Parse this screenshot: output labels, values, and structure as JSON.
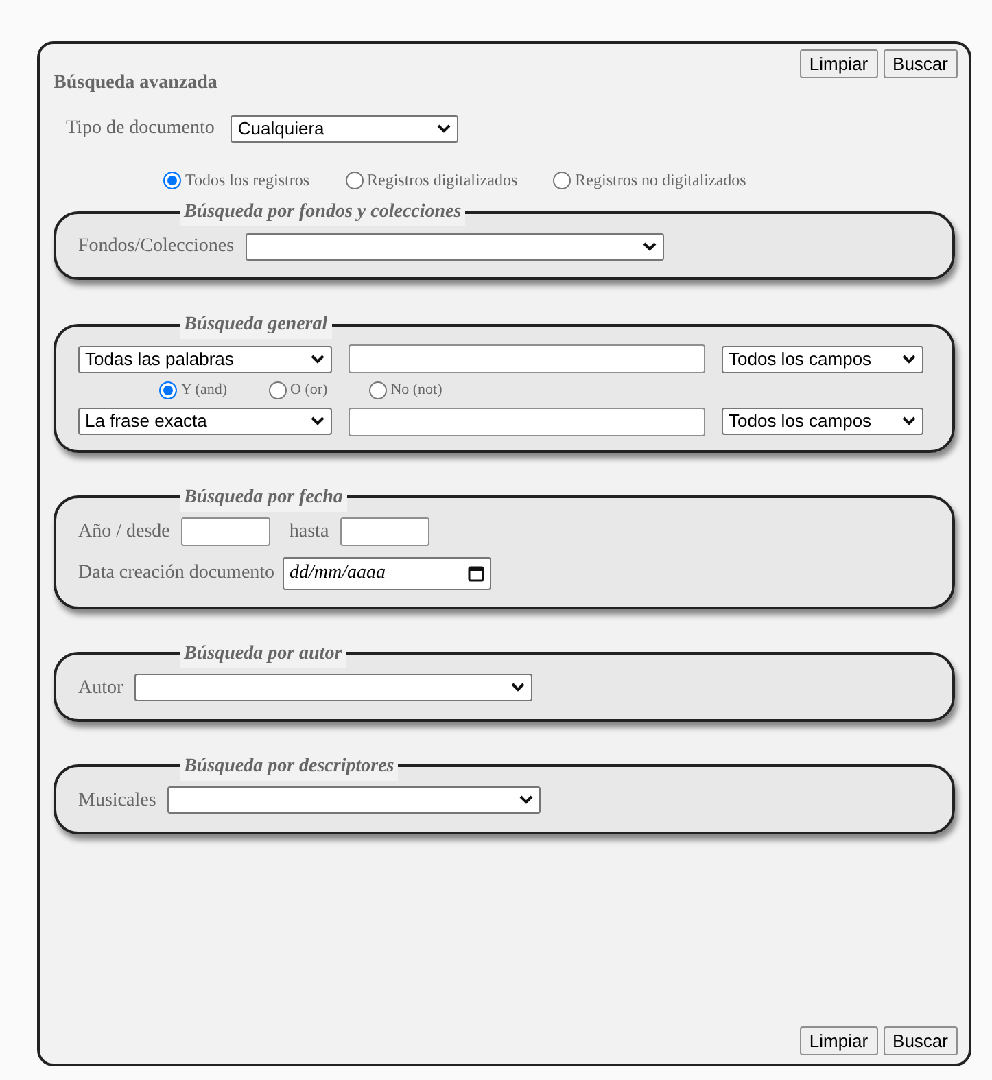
{
  "header": {
    "title": "Búsqueda avanzada",
    "buttons": [
      "Limpiar",
      "Buscar"
    ]
  },
  "document_type": {
    "label": "Tipo de documento",
    "value": "Cualquiera"
  },
  "record_filter": [
    {
      "label": "Todos los registros",
      "selected": true
    },
    {
      "label": "Registros digitalizados",
      "selected": false
    },
    {
      "label": "Registros no digitalizados",
      "selected": false
    }
  ],
  "sections": [
    {
      "kind": "select",
      "legend": "Búsqueda por fondos y colecciones",
      "label": "Fondos/Colecciones"
    },
    {
      "kind": "general",
      "legend": "Búsqueda general",
      "rows": [
        {
          "match": "Todas las palabras",
          "field": "Todos los campos"
        },
        {
          "match": "La frase exacta",
          "field": "Todos los campos"
        }
      ],
      "operators": [
        {
          "label": "Y (and)",
          "selected": true
        },
        {
          "label": "O (or)",
          "selected": false
        },
        {
          "label": "No (not)",
          "selected": false
        }
      ]
    },
    {
      "kind": "dates",
      "legend": "Búsqueda por fecha",
      "from_label": "Año / desde",
      "to_label": "hasta",
      "date_label": "Data creación documento",
      "date_placeholder": "dd/mm/aaaa"
    },
    {
      "kind": "select",
      "legend": "Búsqueda por autor",
      "label": "Autor"
    },
    {
      "kind": "select",
      "legend": "Búsqueda por descriptores",
      "label": "Musicales"
    }
  ],
  "footer": {
    "buttons": [
      "Limpiar",
      "Buscar"
    ]
  }
}
